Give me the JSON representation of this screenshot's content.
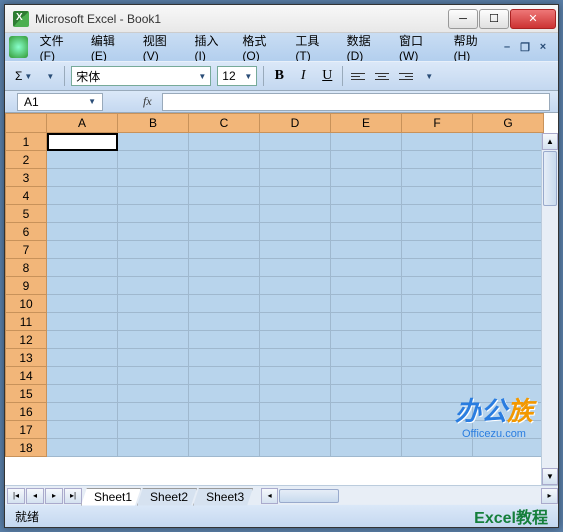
{
  "window": {
    "title": "Microsoft Excel - Book1"
  },
  "menu": {
    "file": "文件",
    "file_k": "F",
    "edit": "编辑",
    "edit_k": "E",
    "view": "视图",
    "view_k": "V",
    "insert": "插入",
    "insert_k": "I",
    "format": "格式",
    "format_k": "O",
    "tools": "工具",
    "tools_k": "T",
    "data": "数据",
    "data_k": "D",
    "window": "窗口",
    "window_k": "W",
    "help": "帮助",
    "help_k": "H"
  },
  "toolbar": {
    "sigma": "Σ",
    "font_name": "宋体",
    "font_size": "12",
    "bold": "B",
    "italic": "I",
    "underline": "U"
  },
  "namebox": {
    "ref": "A1",
    "fx": "fx"
  },
  "columns": [
    "A",
    "B",
    "C",
    "D",
    "E",
    "F",
    "G"
  ],
  "rows": [
    "1",
    "2",
    "3",
    "4",
    "5",
    "6",
    "7",
    "8",
    "9",
    "10",
    "11",
    "12",
    "13",
    "14",
    "15",
    "16",
    "17",
    "18"
  ],
  "active_cell": "A1",
  "tabs": {
    "s1": "Sheet1",
    "s2": "Sheet2",
    "s3": "Sheet3"
  },
  "status": {
    "ready": "就绪",
    "tutorial": "Excel教程"
  },
  "watermark": {
    "brand_a": "办公",
    "brand_b": "族",
    "url": "Officezu.com"
  }
}
